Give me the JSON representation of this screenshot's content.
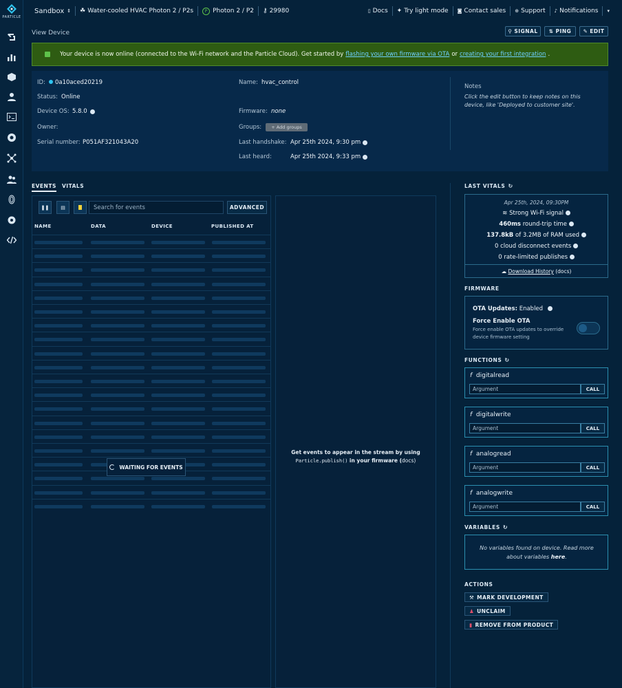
{
  "brand": {
    "name": "PARTICLE"
  },
  "topbar": {
    "org": "Sandbox",
    "product": "Water-cooled HVAC Photon 2 / P2s",
    "platform_badge": "P",
    "platform": "Photon 2 / P2",
    "product_id": "29980",
    "docs": "Docs",
    "light_mode": "Try light mode",
    "contact_sales": "Contact sales",
    "support": "Support",
    "notifications": "Notifications"
  },
  "page": {
    "title": "View Device"
  },
  "header_buttons": {
    "signal": "SIGNAL",
    "ping": "PING",
    "edit": "EDIT"
  },
  "banner": {
    "text_before": "Your device is now online (connected to the Wi-Fi network and the Particle Cloud). Get started by",
    "link1": "flashing your own firmware via OTA",
    "text_mid": "or",
    "link2": "creating your first integration",
    "text_after": "."
  },
  "device": {
    "id_label": "ID:",
    "id": "0a10aced20219",
    "status_label": "Status:",
    "status": "Online",
    "os_label": "Device OS:",
    "os": "5.8.0",
    "owner_label": "Owner:",
    "serial_label": "Serial number:",
    "serial": "P051AF321043A20",
    "name_label": "Name:",
    "name": "hvac_control",
    "firmware_label": "Firmware:",
    "firmware": "none",
    "groups_label": "Groups:",
    "groups_btn": "+ Add groups",
    "handshake_label": "Last handshake:",
    "handshake": "Apr 25th 2024, 9:30 pm",
    "heard_label": "Last heard:",
    "heard": "Apr 25th 2024, 9:33 pm",
    "notes_label": "Notes",
    "notes_text": "Click the edit button to keep notes on this device, like 'Deployed to customer site'."
  },
  "tabs": {
    "events": "EVENTS",
    "vitals": "VITALS"
  },
  "events": {
    "search_placeholder": "Search for events",
    "advanced": "ADVANCED",
    "columns": [
      "NAME",
      "DATA",
      "DEVICE",
      "PUBLISHED AT"
    ],
    "waiting": "WAITING FOR EVENTS",
    "stream_msg_1": "Get events to appear in the stream by using",
    "stream_code": "Particle.publish()",
    "stream_msg_2": "in your firmware (",
    "stream_docs": "docs",
    "stream_msg_3": ")"
  },
  "vitals": {
    "title": "LAST VITALS",
    "timestamp": "Apr 25th, 2024, 09:30PM",
    "signal": "Strong Wi-Fi signal",
    "rtt_val": "460ms",
    "rtt_txt": "round-trip time",
    "ram_val": "137.8kB",
    "ram_txt": "of 3.2MB of RAM used",
    "disconnects": "0 cloud disconnect events",
    "rate_limited": "0 rate-limited publishes",
    "download": "Download History",
    "download_docs": "(docs)"
  },
  "firmware": {
    "title": "FIRMWARE",
    "ota_label": "OTA Updates:",
    "ota_value": "Enabled",
    "force_label": "Force Enable OTA",
    "force_desc": "Force enable OTA updates to override device firmware setting"
  },
  "functions": {
    "title": "FUNCTIONS",
    "items": [
      {
        "name": "digitalread",
        "placeholder": "Argument",
        "button": "CALL"
      },
      {
        "name": "digitalwrite",
        "placeholder": "Argument",
        "button": "CALL"
      },
      {
        "name": "analogread",
        "placeholder": "Argument",
        "button": "CALL"
      },
      {
        "name": "analogwrite",
        "placeholder": "Argument",
        "button": "CALL"
      }
    ]
  },
  "variables": {
    "title": "VARIABLES",
    "msg": "No variables found on device. Read more about variables",
    "link": "here",
    "end": "."
  },
  "actions": {
    "title": "ACTIONS",
    "mark_dev": "MARK DEVELOPMENT",
    "unclaim": "UNCLAIM",
    "remove": "REMOVE FROM PRODUCT"
  },
  "colors": {
    "bg": "#05223a",
    "accent": "#2b8fb0",
    "banner": "#2e5c12",
    "online": "#2ec4f0"
  }
}
